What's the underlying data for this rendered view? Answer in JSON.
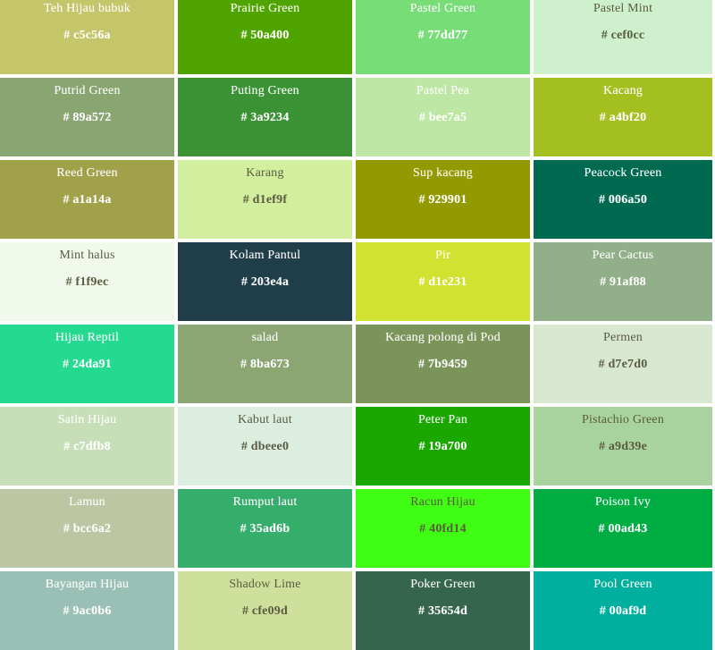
{
  "page": {
    "title": "Green Color Palette Grid",
    "columns": 4,
    "rows": 8,
    "gap_color": "#ffffff",
    "light_text_color": "#ffffff",
    "dark_text_color": "#5b5b3f",
    "hex_prefix": "#"
  },
  "swatches": [
    {
      "name": "Teh Hijau bubuk",
      "hex": "# c5c56a",
      "color": "#c5c56a",
      "text": "light"
    },
    {
      "name": "Prairie Green",
      "hex": "# 50a400",
      "color": "#50a400",
      "text": "light"
    },
    {
      "name": "Pastel Green",
      "hex": "# 77dd77",
      "color": "#77dd77",
      "text": "light"
    },
    {
      "name": "Pastel Mint",
      "hex": "# cef0cc",
      "color": "#cef0cc",
      "text": "dark"
    },
    {
      "name": "Putrid Green",
      "hex": "# 89a572",
      "color": "#89a572",
      "text": "light"
    },
    {
      "name": "Puting Green",
      "hex": "# 3a9234",
      "color": "#3a9234",
      "text": "light"
    },
    {
      "name": "Pastel Pea",
      "hex": "# bee7a5",
      "color": "#bee7a5",
      "text": "light"
    },
    {
      "name": "Kacang",
      "hex": "# a4bf20",
      "color": "#a4bf20",
      "text": "light"
    },
    {
      "name": "Reed Green",
      "hex": "# a1a14a",
      "color": "#a1a14a",
      "text": "light"
    },
    {
      "name": "Karang",
      "hex": "# d1ef9f",
      "color": "#d1ef9f",
      "text": "dark"
    },
    {
      "name": "Sup kacang",
      "hex": "# 929901",
      "color": "#929901",
      "text": "light"
    },
    {
      "name": "Peacock Green",
      "hex": "# 006a50",
      "color": "#006a50",
      "text": "light"
    },
    {
      "name": "Mint halus",
      "hex": "# f1f9ec",
      "color": "#f1f9ec",
      "text": "dark"
    },
    {
      "name": "Kolam Pantul",
      "hex": "# 203e4a",
      "color": "#203e4a",
      "text": "light"
    },
    {
      "name": "Pir",
      "hex": "# d1e231",
      "color": "#d1e231",
      "text": "light"
    },
    {
      "name": "Pear Cactus",
      "hex": "# 91af88",
      "color": "#91af88",
      "text": "light"
    },
    {
      "name": "Hijau Reptil",
      "hex": "# 24da91",
      "color": "#24da91",
      "text": "light"
    },
    {
      "name": "salad",
      "hex": "# 8ba673",
      "color": "#8ba673",
      "text": "light"
    },
    {
      "name": "Kacang polong di Pod",
      "hex": "# 7b9459",
      "color": "#7b9459",
      "text": "light"
    },
    {
      "name": "Permen",
      "hex": "# d7e7d0",
      "color": "#d7e7d0",
      "text": "dark"
    },
    {
      "name": "Satin Hijau",
      "hex": "# c7dfb8",
      "color": "#c7dfb8",
      "text": "light"
    },
    {
      "name": "Kabut laut",
      "hex": "# dbeee0",
      "color": "#dbeee0",
      "text": "dark"
    },
    {
      "name": "Peter Pan",
      "hex": "# 19a700",
      "color": "#19a700",
      "text": "light"
    },
    {
      "name": "Pistachio Green",
      "hex": "# a9d39e",
      "color": "#a9d39e",
      "text": "dark"
    },
    {
      "name": "Lamun",
      "hex": "# bcc6a2",
      "color": "#bcc6a2",
      "text": "light"
    },
    {
      "name": "Rumput laut",
      "hex": "# 35ad6b",
      "color": "#35ad6b",
      "text": "light"
    },
    {
      "name": "Racun Hijau",
      "hex": "# 40fd14",
      "color": "#40fd14",
      "text": "dark"
    },
    {
      "name": "Poison Ivy",
      "hex": "# 00ad43",
      "color": "#00ad43",
      "text": "light"
    },
    {
      "name": "Bayangan Hijau",
      "hex": "# 9ac0b6",
      "color": "#9ac0b6",
      "text": "light"
    },
    {
      "name": "Shadow Lime",
      "hex": "# cfe09d",
      "color": "#cfe09d",
      "text": "dark"
    },
    {
      "name": "Poker Green",
      "hex": "# 35654d",
      "color": "#35654d",
      "text": "light"
    },
    {
      "name": "Pool Green",
      "hex": "# 00af9d",
      "color": "#00af9d",
      "text": "light"
    }
  ]
}
